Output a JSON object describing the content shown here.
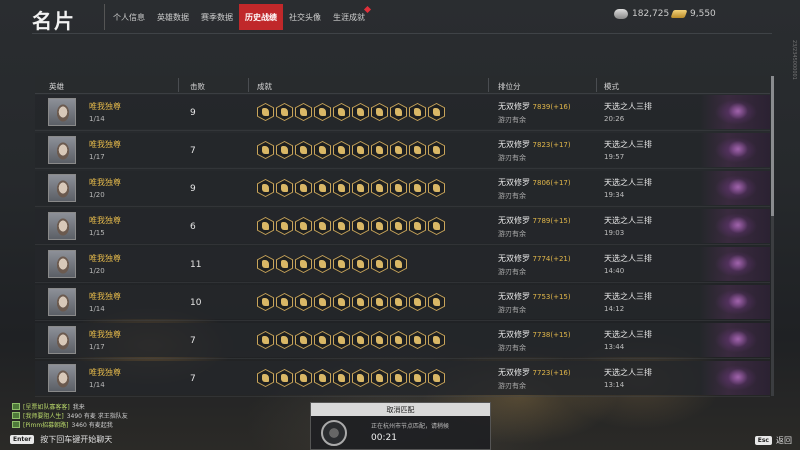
{
  "header": {
    "title": "名片",
    "tabs": [
      {
        "label": "个人信息"
      },
      {
        "label": "英雄数据"
      },
      {
        "label": "赛季数据"
      },
      {
        "label": "历史战绩"
      },
      {
        "label": "社交头像"
      },
      {
        "label": "生涯成就"
      }
    ],
    "active_tab": "历史战绩",
    "currency_silver": "182,725",
    "currency_gold": "9,550",
    "side_id": "23/2345000001"
  },
  "table": {
    "columns": {
      "hero": "英雄",
      "kills": "击败",
      "achievements": "成就",
      "rank": "排位分",
      "mode": "模式"
    },
    "rows": [
      {
        "hero": "唯我独尊",
        "placement": "1/14",
        "kills": "9",
        "badges": 10,
        "rank_name": "无双修罗",
        "score": "7839(+16)",
        "rank_sub": "游刃有余",
        "mode": "天选之人三排",
        "time": "20:26"
      },
      {
        "hero": "唯我独尊",
        "placement": "1/17",
        "kills": "7",
        "badges": 10,
        "rank_name": "无双修罗",
        "score": "7823(+17)",
        "rank_sub": "游刃有余",
        "mode": "天选之人三排",
        "time": "19:57"
      },
      {
        "hero": "唯我独尊",
        "placement": "1/20",
        "kills": "9",
        "badges": 10,
        "rank_name": "无双修罗",
        "score": "7806(+17)",
        "rank_sub": "游刃有余",
        "mode": "天选之人三排",
        "time": "19:34"
      },
      {
        "hero": "唯我独尊",
        "placement": "1/15",
        "kills": "6",
        "badges": 10,
        "rank_name": "无双修罗",
        "score": "7789(+15)",
        "rank_sub": "游刃有余",
        "mode": "天选之人三排",
        "time": "19:03"
      },
      {
        "hero": "唯我独尊",
        "placement": "1/20",
        "kills": "11",
        "badges": 8,
        "rank_name": "无双修罗",
        "score": "7774(+21)",
        "rank_sub": "游刃有余",
        "mode": "天选之人三排",
        "time": "14:40"
      },
      {
        "hero": "唯我独尊",
        "placement": "1/14",
        "kills": "10",
        "badges": 10,
        "rank_name": "无双修罗",
        "score": "7753(+15)",
        "rank_sub": "游刃有余",
        "mode": "天选之人三排",
        "time": "14:12"
      },
      {
        "hero": "唯我独尊",
        "placement": "1/17",
        "kills": "7",
        "badges": 10,
        "rank_name": "无双修罗",
        "score": "7738(+15)",
        "rank_sub": "游刃有余",
        "mode": "天选之人三排",
        "time": "13:44"
      },
      {
        "hero": "唯我独尊",
        "placement": "1/14",
        "kills": "7",
        "badges": 10,
        "rank_name": "无双修罗",
        "score": "7723(+16)",
        "rank_sub": "游刃有余",
        "mode": "天选之人三排",
        "time": "13:14"
      }
    ]
  },
  "chat": {
    "lines": [
      {
        "tag": "[呈票如队寡客客]",
        "text": "我来"
      },
      {
        "tag": "[我师要阻人生]",
        "text": "3490 有麦 求王指队友"
      },
      {
        "tag": "[Pimm招募朝路]",
        "text": "3460 有麦起我"
      }
    ],
    "enter_key": "Enter",
    "prompt": "按下回车键开始聊天"
  },
  "matching": {
    "cancel_label": "取消匹配",
    "info": "正在杭州市节点匹配，请稍候",
    "time": "00:21"
  },
  "exit": {
    "key": "Esc",
    "label": "返回"
  },
  "colors": {
    "accent_red": "#c0282a",
    "gold_text": "#e0b64a"
  }
}
